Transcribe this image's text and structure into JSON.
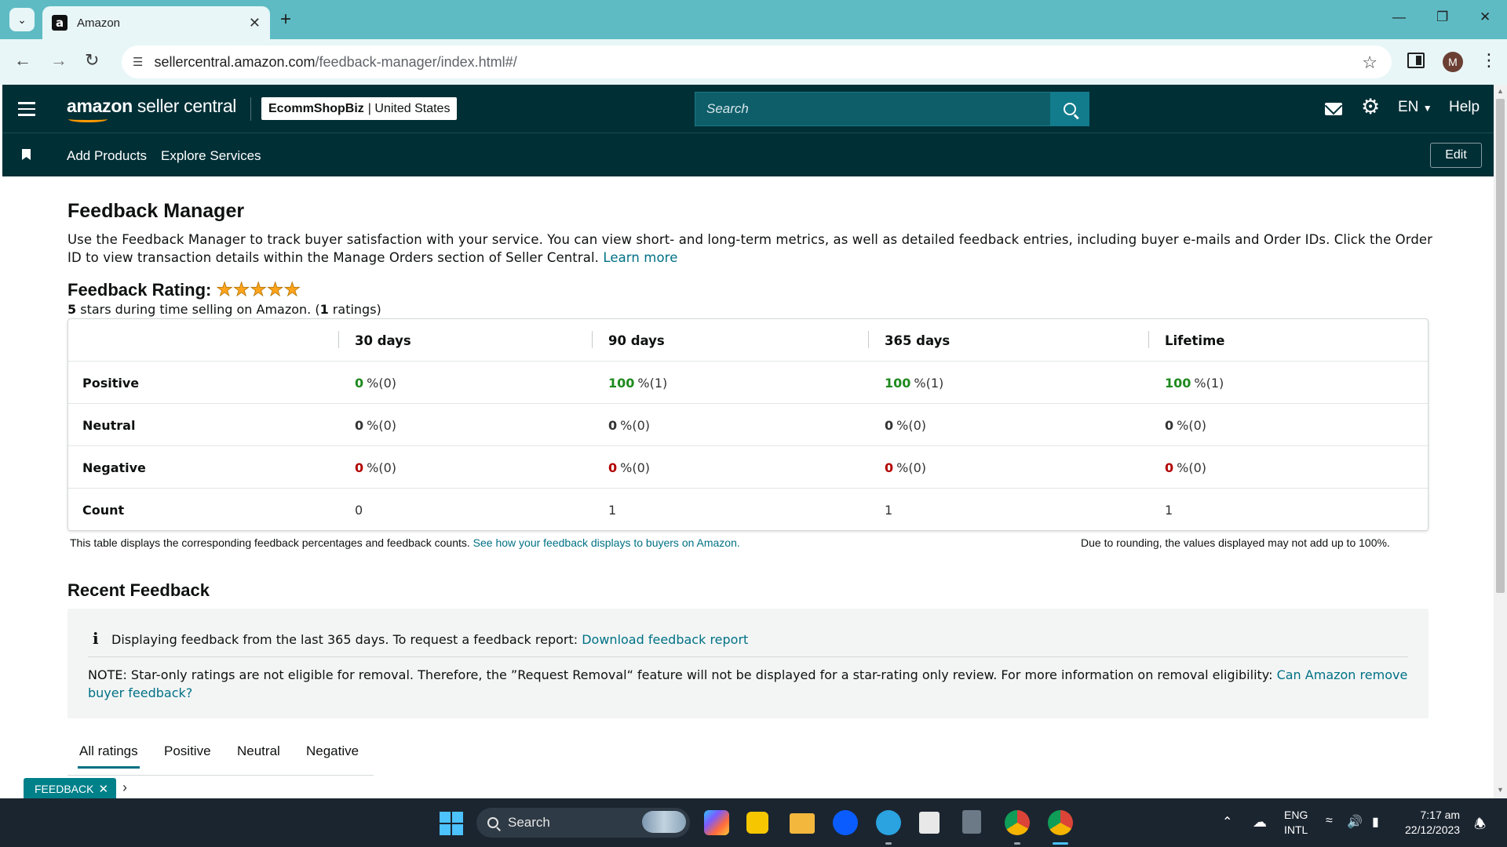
{
  "browser": {
    "tab_title": "Amazon",
    "tab_favicon": "a",
    "url_host": "sellercentral.amazon.com",
    "url_path": "/feedback-manager/index.html#/",
    "profile_initial": "M"
  },
  "header": {
    "logo_brand": "amazon",
    "logo_product": " seller central",
    "store_name": "EcommShopBiz",
    "store_region": "| United States",
    "search_placeholder": "Search",
    "language": "EN",
    "help": "Help"
  },
  "subnav": {
    "links": [
      "Add Products",
      "Explore Services"
    ],
    "edit": "Edit"
  },
  "page": {
    "title": "Feedback Manager",
    "intro": "Use the Feedback Manager to track buyer satisfaction with your service. You can view short- and long-term metrics, as well as detailed feedback entries, including buyer e-mails and Order IDs. Click the Order ID to view transaction details within the Manage Orders section of Seller Central.",
    "learn_more": "Learn more",
    "rating_label": "Feedback Rating:",
    "rating_stars": 5,
    "rating_sub_stars": "5",
    "rating_sub_text1": " stars during time selling on Amazon. (",
    "rating_sub_count": "1",
    "rating_sub_text2": " ratings)"
  },
  "table": {
    "columns": [
      "30 days",
      "90 days",
      "365 days",
      "Lifetime"
    ],
    "rows": [
      {
        "label": "Positive",
        "kind": "good",
        "cells": [
          [
            "0",
            " %(0)"
          ],
          [
            "100",
            " %(1)"
          ],
          [
            "100",
            " %(1)"
          ],
          [
            "100",
            " %(1)"
          ]
        ]
      },
      {
        "label": "Neutral",
        "kind": "neu",
        "cells": [
          [
            "0",
            " %(0)"
          ],
          [
            "0",
            " %(0)"
          ],
          [
            "0",
            " %(0)"
          ],
          [
            "0",
            " %(0)"
          ]
        ]
      },
      {
        "label": "Negative",
        "kind": "bad",
        "cells": [
          [
            "0",
            " %(0)"
          ],
          [
            "0",
            " %(0)"
          ],
          [
            "0",
            " %(0)"
          ],
          [
            "0",
            " %(0)"
          ]
        ]
      },
      {
        "label": "Count",
        "kind": "plain",
        "cells": [
          [
            "",
            "0"
          ],
          [
            "",
            "1"
          ],
          [
            "",
            "1"
          ],
          [
            "",
            "1"
          ]
        ]
      }
    ],
    "note": "This table displays the corresponding feedback percentages and feedback counts.",
    "note_link": "See how your feedback displays to buyers on Amazon.",
    "note_right": "Due to rounding, the values displayed may not add up to 100%."
  },
  "recent": {
    "title": "Recent Feedback",
    "info_text": "Displaying feedback from the last 365 days. To request a feedback report:",
    "info_link": "Download feedback report",
    "note_text": "NOTE: Star-only ratings are not eligible for removal. Therefore, the ”Request Removal“ feature will not be displayed for a star-rating only review. For more information on removal eligibility:",
    "note_link": "Can Amazon remove buyer feedback?",
    "tabs": [
      "All ratings",
      "Positive",
      "Neutral",
      "Negative"
    ]
  },
  "feedback_chip": "FEEDBACK",
  "taskbar": {
    "search": "Search",
    "lang1": "ENG",
    "lang2": "INTL",
    "time": "7:17 am",
    "date": "22/12/2023"
  },
  "colors": {
    "header_bg": "#002f36",
    "link": "#007185",
    "positive": "#1e8a1e",
    "negative": "#b20000",
    "star": "#ffa41c"
  }
}
